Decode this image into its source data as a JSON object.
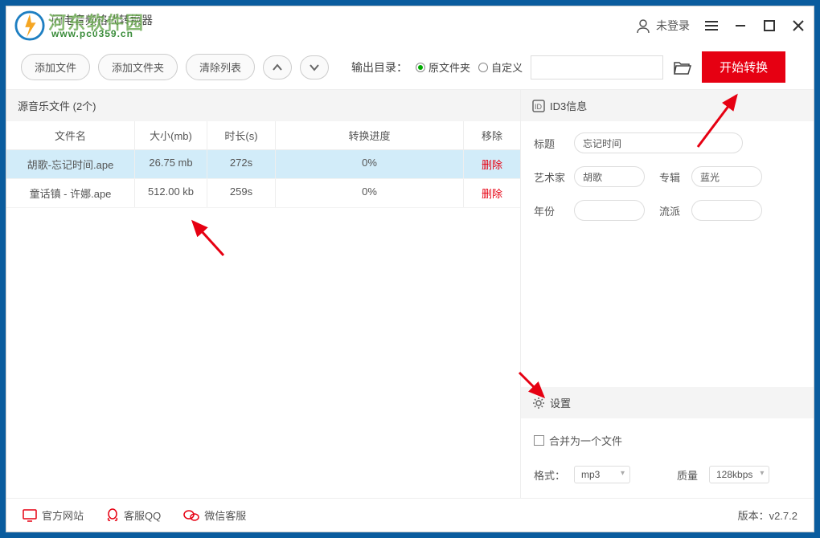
{
  "watermark": "河东软件园",
  "app": {
    "title": "闪电音频格式转换器",
    "url": "www.pc0359.cn"
  },
  "header": {
    "login": "未登录"
  },
  "toolbar": {
    "add_file": "添加文件",
    "add_folder": "添加文件夹",
    "clear_list": "清除列表",
    "output_label": "输出目录：",
    "radio_original": "原文件夹",
    "radio_custom": "自定义",
    "start": "开始转换"
  },
  "filelist": {
    "title": "源音乐文件 (2个)",
    "cols": {
      "name": "文件名",
      "size": "大小(mb)",
      "dur": "时长(s)",
      "prog": "转换进度",
      "del": "移除"
    },
    "rows": [
      {
        "name": "胡歌-忘记时间.ape",
        "size": "26.75 mb",
        "dur": "272s",
        "prog": "0%",
        "del": "删除",
        "selected": true
      },
      {
        "name": "童话镇 - 许娜.ape",
        "size": "512.00 kb",
        "dur": "259s",
        "prog": "0%",
        "del": "删除",
        "selected": false
      }
    ]
  },
  "id3": {
    "title": "ID3信息",
    "labels": {
      "title": "标题",
      "artist": "艺术家",
      "album": "专辑",
      "year": "年份",
      "genre": "流派"
    },
    "values": {
      "title": "忘记时间",
      "artist": "胡歌",
      "album": "蓝光",
      "year": "",
      "genre": ""
    }
  },
  "settings": {
    "title": "设置",
    "merge": "合并为一个文件",
    "format_label": "格式：",
    "format_value": "mp3",
    "quality_label": "质量",
    "quality_value": "128kbps"
  },
  "footer": {
    "site": "官方网站",
    "qq": "客服QQ",
    "wechat": "微信客服",
    "version": "版本：v2.7.2"
  }
}
